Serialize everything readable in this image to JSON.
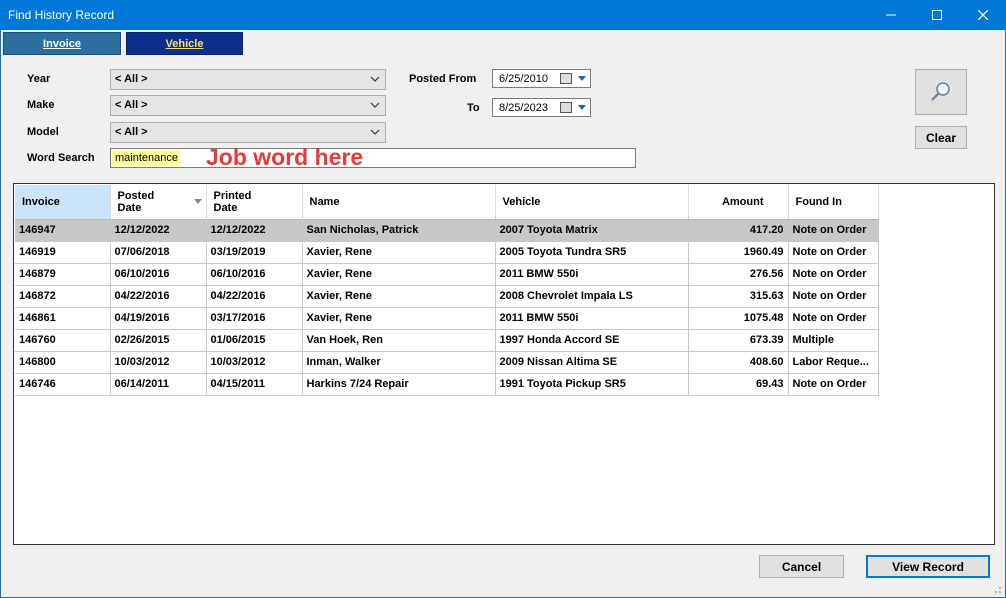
{
  "window": {
    "title": "Find History Record"
  },
  "tabs": {
    "invoice": "Invoice",
    "vehicle": "Vehicle"
  },
  "filters": {
    "year_label": "Year",
    "year_value": "< All >",
    "make_label": "Make",
    "make_value": "< All >",
    "model_label": "Model",
    "model_value": "< All >",
    "word_label": "Word Search",
    "word_value": "maintenance",
    "hint": "Job word here",
    "posted_from_label": "Posted From",
    "posted_from_value": "6/25/2010",
    "to_label": "To",
    "to_value": "8/25/2023"
  },
  "buttons": {
    "clear": "Clear",
    "cancel": "Cancel",
    "view_record": "View Record"
  },
  "table": {
    "columns": {
      "invoice": "Invoice",
      "posted_1": "Posted",
      "posted_2": "Date",
      "printed_1": "Printed",
      "printed_2": "Date",
      "name": "Name",
      "vehicle": "Vehicle",
      "amount": "Amount",
      "found_in": "Found In"
    },
    "rows": [
      [
        "146947",
        "12/12/2022",
        "12/12/2022",
        "San Nicholas, Patrick",
        "2007 Toyota Matrix",
        "417.20",
        "Note on Order"
      ],
      [
        "146919",
        "07/06/2018",
        "03/19/2019",
        "Xavier, Rene",
        "2005 Toyota Tundra SR5",
        "1960.49",
        "Note on Order"
      ],
      [
        "146879",
        "06/10/2016",
        "06/10/2016",
        "Xavier, Rene",
        "2011 BMW 550i",
        "276.56",
        "Note on Order"
      ],
      [
        "146872",
        "04/22/2016",
        "04/22/2016",
        "Xavier, Rene",
        "2008 Chevrolet Impala LS",
        "315.63",
        "Note on Order"
      ],
      [
        "146861",
        "04/19/2016",
        "03/17/2016",
        "Xavier, Rene",
        "2011 BMW 550i",
        "1075.48",
        "Note on Order"
      ],
      [
        "146760",
        "02/26/2015",
        "01/06/2015",
        "Van Hoek, Ren",
        "1997 Honda Accord SE",
        "673.39",
        "Multiple"
      ],
      [
        "146800",
        "10/03/2012",
        "10/03/2012",
        "Inman, Walker",
        "2009 Nissan Altima SE",
        "408.60",
        "Labor Reque..."
      ],
      [
        "146746",
        "06/14/2011",
        "04/15/2011",
        "Harkins 7/24 Repair",
        "1991 Toyota Pickup SR5",
        "69.43",
        "Note on Order"
      ]
    ]
  },
  "colors": {
    "titlebar": "#0078d7",
    "hint": "#e43b3b",
    "highlight": "#ffff99",
    "selected_row": "#c8c8c8"
  }
}
